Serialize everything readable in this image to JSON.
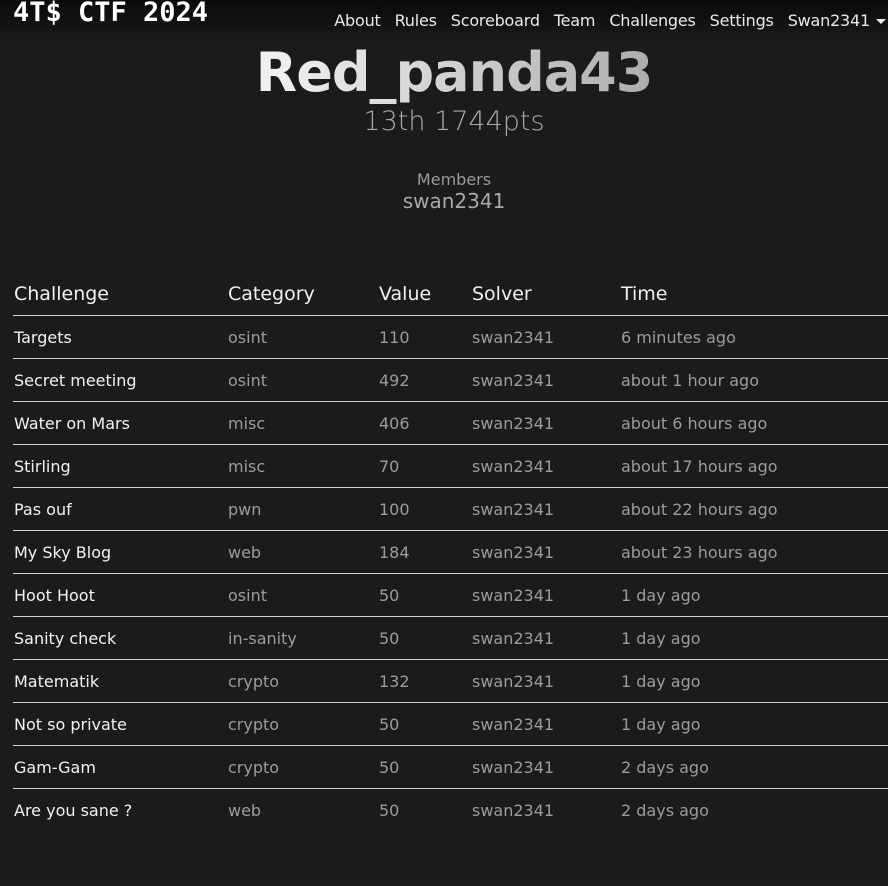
{
  "nav": {
    "brand": "4T$ CTF 2024",
    "links": [
      "About",
      "Rules",
      "Scoreboard",
      "Team",
      "Challenges",
      "Settings"
    ],
    "user": "Swan2341"
  },
  "team": {
    "name": "Red_panda43",
    "stats": "13th 1744pts",
    "members_label": "Members",
    "members": [
      "swan2341"
    ]
  },
  "solves": {
    "headers": [
      "Challenge",
      "Category",
      "Value",
      "Solver",
      "Time"
    ],
    "rows": [
      {
        "challenge": "Targets",
        "category": "osint",
        "value": "110",
        "solver": "swan2341",
        "time": "6 minutes ago"
      },
      {
        "challenge": "Secret meeting",
        "category": "osint",
        "value": "492",
        "solver": "swan2341",
        "time": "about 1 hour ago"
      },
      {
        "challenge": "Water on Mars",
        "category": "misc",
        "value": "406",
        "solver": "swan2341",
        "time": "about 6 hours ago"
      },
      {
        "challenge": "Stirling",
        "category": "misc",
        "value": "70",
        "solver": "swan2341",
        "time": "about 17 hours ago"
      },
      {
        "challenge": "Pas ouf",
        "category": "pwn",
        "value": "100",
        "solver": "swan2341",
        "time": "about 22 hours ago"
      },
      {
        "challenge": "My Sky Blog",
        "category": "web",
        "value": "184",
        "solver": "swan2341",
        "time": "about 23 hours ago"
      },
      {
        "challenge": "Hoot Hoot",
        "category": "osint",
        "value": "50",
        "solver": "swan2341",
        "time": "1 day ago"
      },
      {
        "challenge": "Sanity check",
        "category": "in-sanity",
        "value": "50",
        "solver": "swan2341",
        "time": "1 day ago"
      },
      {
        "challenge": "Matematik",
        "category": "crypto",
        "value": "132",
        "solver": "swan2341",
        "time": "1 day ago"
      },
      {
        "challenge": "Not so private",
        "category": "crypto",
        "value": "50",
        "solver": "swan2341",
        "time": "1 day ago"
      },
      {
        "challenge": "Gam-Gam",
        "category": "crypto",
        "value": "50",
        "solver": "swan2341",
        "time": "2 days ago"
      },
      {
        "challenge": "Are you sane ?",
        "category": "web",
        "value": "50",
        "solver": "swan2341",
        "time": "2 days ago"
      }
    ]
  }
}
